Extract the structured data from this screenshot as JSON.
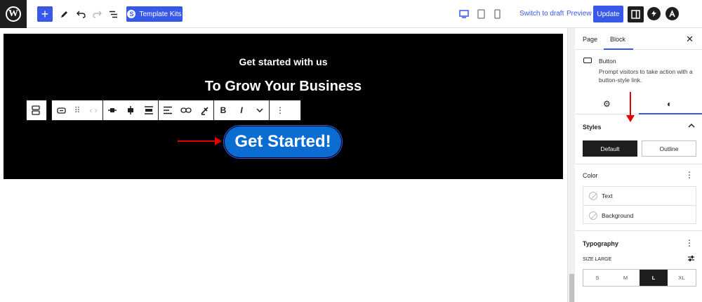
{
  "topbar": {
    "logo_letter": "W",
    "add_label": "+",
    "template_kits_label": "Template Kits",
    "switch_draft_label": "Switch to draft",
    "preview_label": "Preview",
    "update_label": "Update"
  },
  "hero": {
    "subtitle": "Get started with us",
    "title": "To Grow Your Business",
    "cta_label": "Get Started!"
  },
  "toolbar": {
    "bold": "B",
    "italic": "I"
  },
  "panel": {
    "tab_page": "Page",
    "tab_block": "Block",
    "block_name": "Button",
    "block_desc": "Prompt visitors to take action with a button-style link.",
    "styles_heading": "Styles",
    "style_default": "Default",
    "style_outline": "Outline",
    "color_heading": "Color",
    "color_text": "Text",
    "color_background": "Background",
    "typography_heading": "Typography",
    "size_label": "SIZE",
    "size_value": "LARGE",
    "sizes": [
      "S",
      "M",
      "L",
      "XL"
    ],
    "selected_size": "L"
  },
  "colors": {
    "accent": "#3858e9",
    "cta": "#0b6dd1",
    "annotation": "#e30000"
  }
}
